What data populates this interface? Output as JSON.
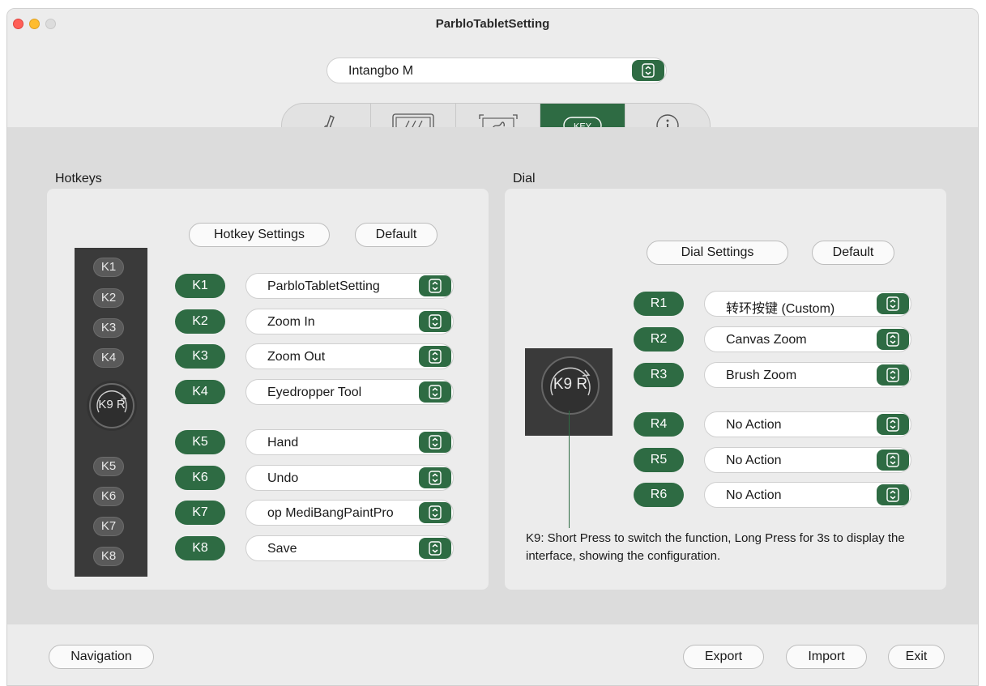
{
  "window": {
    "title": "ParbloTabletSetting"
  },
  "device": {
    "selected": "Intangbo M"
  },
  "tabs": [
    {
      "id": "pen",
      "icon": "pen-icon"
    },
    {
      "id": "work-area",
      "icon": "work-area-icon"
    },
    {
      "id": "mapping",
      "icon": "mapping-icon"
    },
    {
      "id": "key",
      "icon": "key-icon",
      "label": "KEY",
      "active": true
    },
    {
      "id": "info",
      "icon": "info-icon"
    }
  ],
  "hotkeys": {
    "section_label": "Hotkeys",
    "settings_button": "Hotkey Settings",
    "default_button": "Default",
    "strip_keys": [
      "K1",
      "K2",
      "K3",
      "K4",
      "K5",
      "K6",
      "K7",
      "K8"
    ],
    "strip_dial": "K9 R",
    "rows": [
      {
        "key": "K1",
        "value": "ParbloTabletSetting"
      },
      {
        "key": "K2",
        "value": "Zoom In"
      },
      {
        "key": "K3",
        "value": "Zoom Out"
      },
      {
        "key": "K4",
        "value": "Eyedropper Tool"
      },
      {
        "key": "K5",
        "value": "Hand"
      },
      {
        "key": "K6",
        "value": "Undo"
      },
      {
        "key": "K7",
        "value": "op MediBangPaintPro"
      },
      {
        "key": "K8",
        "value": "Save"
      }
    ]
  },
  "dial": {
    "section_label": "Dial",
    "settings_button": "Dial Settings",
    "default_button": "Default",
    "dial_label": "K9 R",
    "rows": [
      {
        "key": "R1",
        "value": "转环按键 (Custom)"
      },
      {
        "key": "R2",
        "value": "Canvas Zoom"
      },
      {
        "key": "R3",
        "value": "Brush Zoom"
      },
      {
        "key": "R4",
        "value": "No Action"
      },
      {
        "key": "R5",
        "value": "No Action"
      },
      {
        "key": "R6",
        "value": "No Action"
      }
    ],
    "note": "K9: Short Press to switch the function, Long Press for 3s to display the interface, showing the configuration."
  },
  "footer": {
    "navigation": "Navigation",
    "export": "Export",
    "import": "Import",
    "exit": "Exit"
  },
  "colors": {
    "accent": "#2e6b43",
    "window_bg": "#ececec",
    "content_bg": "#dcdcdc",
    "strip_bg": "#3a3a3a"
  }
}
